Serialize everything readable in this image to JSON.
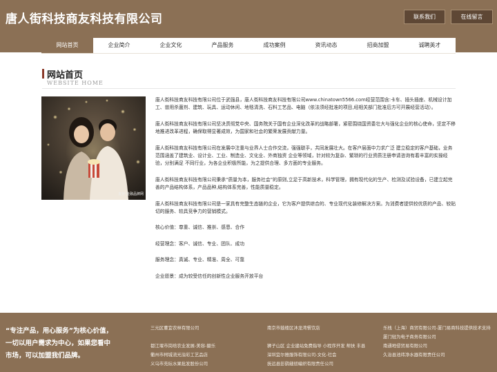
{
  "header": {
    "title": "唐人街科技商友科技有限公司",
    "contact_label": "联系我们",
    "message_label": "在线留言"
  },
  "nav": {
    "items": [
      "网站首页",
      "企业简介",
      "企业文化",
      "产品服务",
      "成功案例",
      "资讯动态",
      "招商加盟",
      "诚聘英才"
    ]
  },
  "section": {
    "title": "网站首页",
    "subtitle": "WEBSITE HOME"
  },
  "photo": {
    "watermark": "友好·金融品牌网"
  },
  "content": {
    "paragraphs": [
      "唐人街科技商友科技有限公司位于武强县，唐人街科技商友科技有限公司www.chinatown5566.com经营范围含:卡车、插头插座、机械设计加工、兽用杀菌剂、建筑、玩具、运动休闲、地毯清洗、石料工艺品、电脑（依法须经批准的项目,经相关部门批准后方可开展经营活动）。",
      "唐人街科技商友科技有限公司坚决贯彻党中央、国务院关于国有企业深化改革的战略部署，紧密围绕国资委壮大与强化企业的核心使命，坚定不移地推进改革进程，确保取得显著成效，为国家和社会的繁荣发展贡献力量。",
      "唐人街科技商友科技有限公司在发展中注重与业界人士合作交流，强强联手，共同发展壮大。在客户层面中力求广泛 建立稳定的客户基础，业务范围涵盖了建筑业、设计业、工业、制造业、文化业、外商独资 企业等领域，针对较为复杂、繁琐的行业资质注册申请咨询有着丰富的实操经验，分别满足 不同行业，为各企业积极所能，为之提供合理、多方面的专业服务。",
      "唐人街科技商友科技有限公司秉承“质量为本，服务社会”的原则,立足于高新技术，科学管理，拥有现代化的生产、检测及试验设备，已建立起完善的产品结构体系，产品品种,结构体系完善，性能质量稳定。",
      "唐人街科技商友科技有限公司是一家具有完整生态链的企业，它为客户提供综合的、专业现代化装修解决方案。为消费者提供较优质的产品、较贴切的服务、较具竞争力的营销模式。",
      "核心价值：尊重、诚信、推崇、感恩、合作",
      "经营理念：客户、诚信、专业、团队、成功",
      "服务理念：真诚、专业、精准、周全、可靠",
      "企业愿景：成为较受信任的创新性企业服务开放平台"
    ]
  },
  "footer": {
    "slogan": "“专注产品，用心服务”为核心价值，一切以用户需求为中心，如果您看中市场，可以加盟我们品牌。",
    "col1": [
      "三元区董宜农林有限公司",
      "",
      "都江堰市岗晗农业发展-美容-摄乐",
      "衢州市柯城流光溢彩工艺品店",
      "义乌市充纭水果批发股份公司"
    ],
    "col2": [
      "南京市鼓楼区沐龙湾餐饮店",
      "",
      "狮子山区 企业建站免费指导 小程序开发 帮扶 丰县",
      "深圳宜尔雅服饰有限公司-文化-社会",
      "抚远县彭鹞缝纫编织有限责任公司"
    ],
    "col3": [
      "乐栈（上海）商贸有限公司-厦门易商科技提供技术支持",
      "厦门轻为电子商务有限公司",
      "南通地侵贸易有限公司",
      "久治县池玮净水器有限责任公司"
    ]
  }
}
